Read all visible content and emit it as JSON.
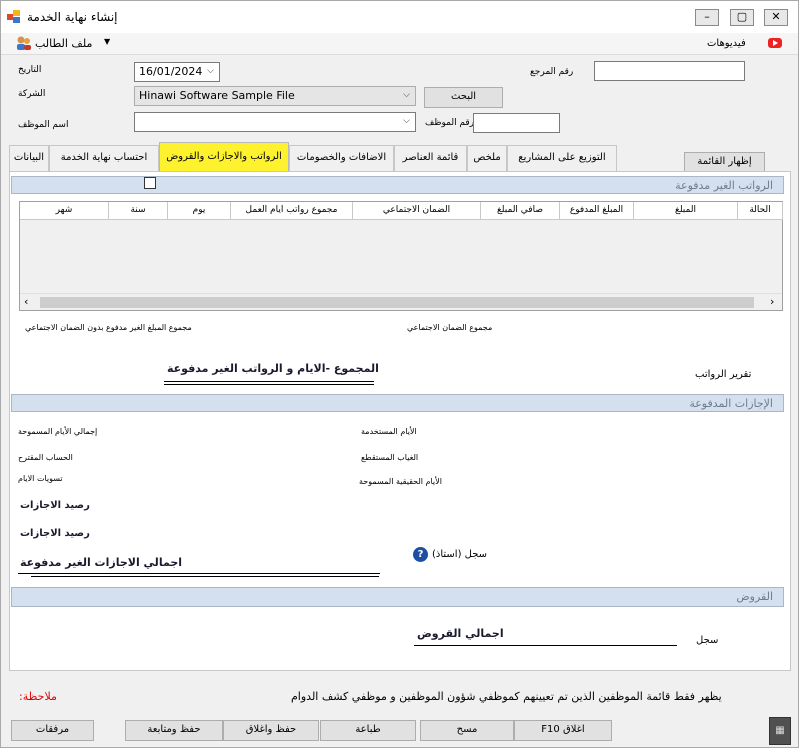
{
  "window": {
    "title": "إنشاء نهاية الخدمة",
    "min": "–",
    "max": "▢",
    "close": "✕"
  },
  "menu": {
    "student_file": "ملف الطالب",
    "videos": "فيديوهات"
  },
  "form": {
    "date_label": "التاريخ",
    "date_value": "16/01/2024",
    "ref_label": "رقم المرجع",
    "ref_value": "",
    "company_label": "الشركة",
    "company_value": "Hinawi Software Sample File",
    "search_btn": "البحث",
    "emp_name_label": "اسم الموظف",
    "emp_name_value": "",
    "emp_no_label": "رقم الموظف",
    "emp_no_value": ""
  },
  "show_list_btn": "إظهار القائمة",
  "tabs": [
    "البيانات",
    "احتساب نهاية الخدمة",
    "الرواتب والاجازات والقروض",
    "ملخص",
    "قائمة العناصر",
    "الاضافات والخصومات",
    "التوزيع على المشاريع"
  ],
  "active_tab": "الرواتب والاجازات والقروض",
  "unpaid_salaries": {
    "section_title": "الرواتب الغير مدفوعة",
    "columns": [
      "الحالة",
      "المبلغ",
      "المبلغ المدفوع",
      "صافي المبلغ",
      "الضمان الاجتماعي",
      "مجموع رواتب ايام العمل",
      "يوم",
      "سنة",
      "شهر"
    ],
    "total_no_ss_label": "مجموع المبلغ الغير مدفوع بدون الضمان الاجتماعي",
    "total_ss_label": "مجموع الضمان الاجتماعي",
    "sum_label": "المجموع  -الايام و الرواتب الغير مدفوعة",
    "report_label": "تقرير الرواتب"
  },
  "paid_leaves": {
    "section_title": "الإجازات المدفوعة",
    "total_allowed": "إجمالي الأيام المسموحة",
    "used_days": "الأيام المستخدمة",
    "proposed_account": "الحساب المقترح",
    "deducted_absence": "الغياب المستقطع",
    "day_settlements": "تسويات الايام",
    "actual_allowed": "الأيام الحقيقية المسموحة",
    "balance_1": "رصيد الاجازات",
    "balance_2": "رصيد الاجازات",
    "record_label": "سجل (استاذ)",
    "unpaid_total": "اجمالي الاجازات الغير مدفوعة"
  },
  "loans": {
    "section_title": "القروض",
    "total": "اجمالي القروض",
    "record": "سجل"
  },
  "note": {
    "label": ":ملاحظة",
    "text": "يظهر فقط قائمة الموظفين الذين تم تعيينهم كموظفي شؤون الموظفين و موظفي كشف الدوام"
  },
  "footer": {
    "close": "F10 اغلاق",
    "clear": "مسح",
    "print": "طباعة",
    "save_close": "حفظ واغلاق",
    "save_continue": "حفظ ومتابعة",
    "attachments": "مرفقات"
  },
  "colors": {
    "active_tab": "#fdf22d",
    "section": "#d5e0ee",
    "note_label": "#e00000"
  }
}
